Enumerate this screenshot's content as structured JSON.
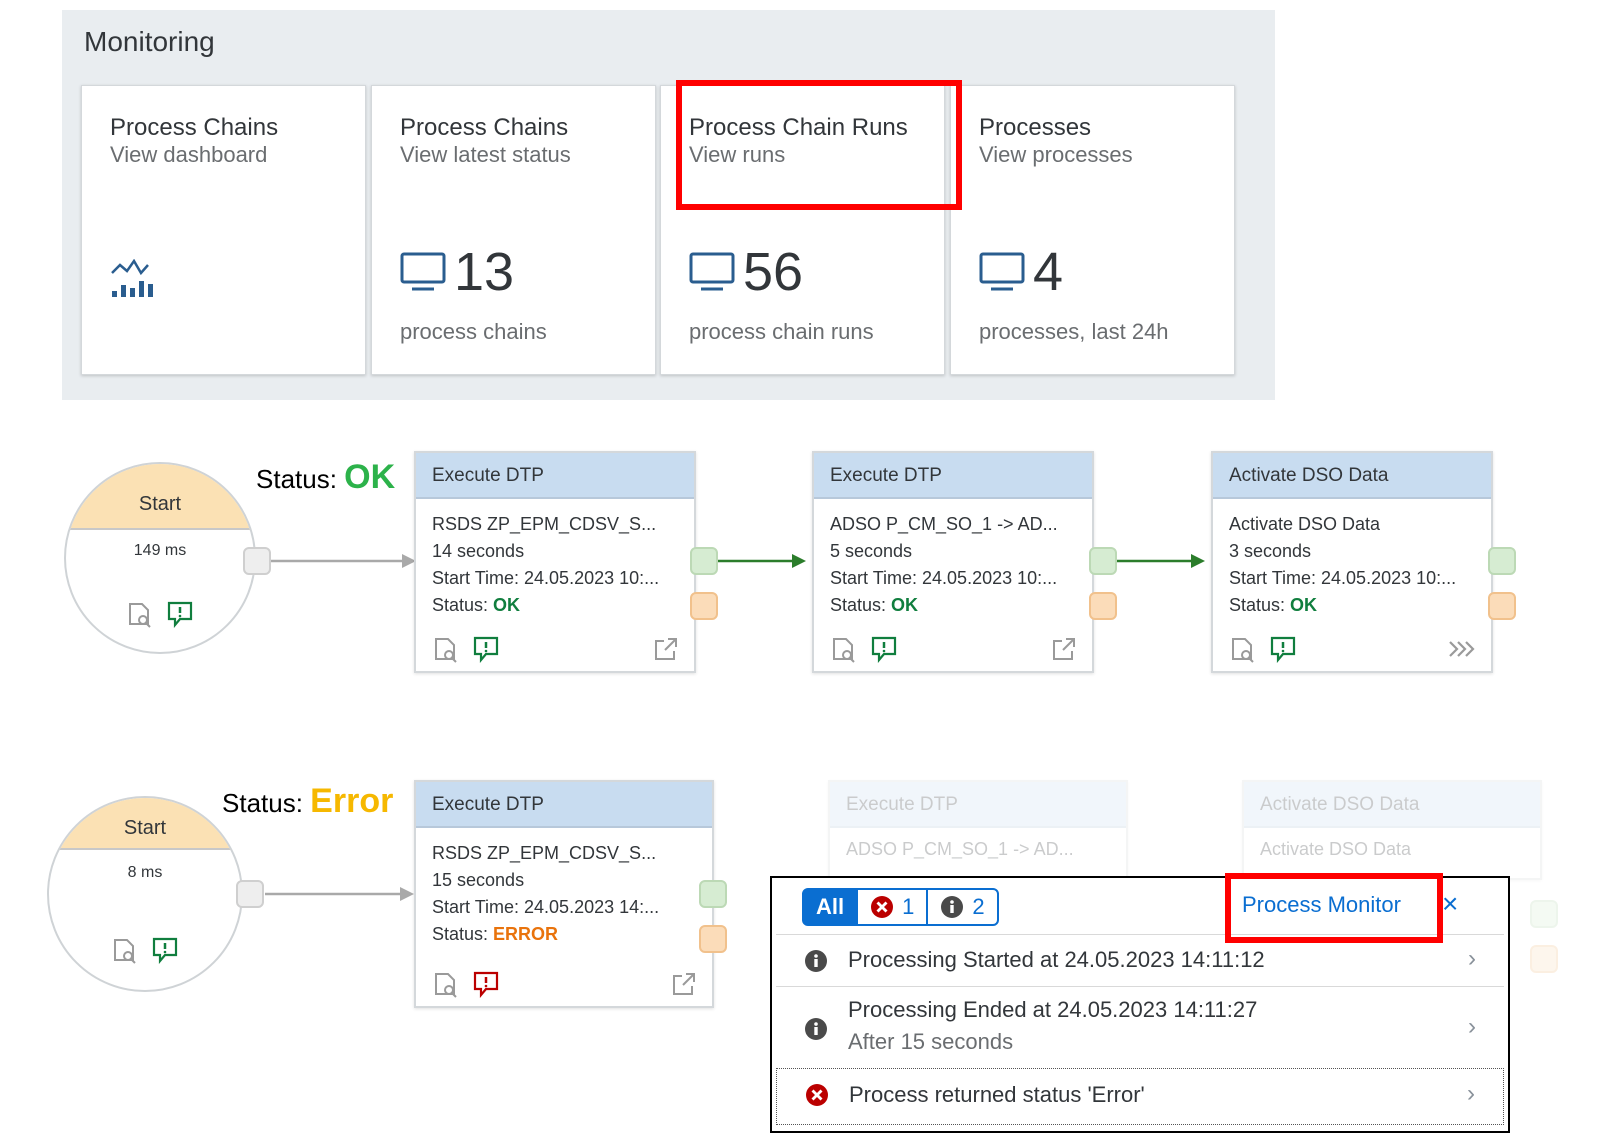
{
  "monitoring": {
    "title": "Monitoring",
    "tiles": [
      {
        "title": "Process Chains",
        "subtitle": "View dashboard",
        "icon": "chart-dashboard-icon",
        "value": "",
        "footer": ""
      },
      {
        "title": "Process Chains",
        "subtitle": "View latest status",
        "icon": "monitor-icon",
        "value": "13",
        "footer": "process chains"
      },
      {
        "title": "Process Chain Runs",
        "subtitle": "View runs",
        "icon": "monitor-icon",
        "value": "56",
        "footer": "process chain runs"
      },
      {
        "title": "Processes",
        "subtitle": "View processes",
        "icon": "monitor-icon",
        "value": "4",
        "footer": "processes, last 24h"
      }
    ]
  },
  "flow_ok": {
    "status_prefix": "Status:",
    "status_value": "OK",
    "start": {
      "label": "Start",
      "duration": "149 ms"
    },
    "nodes": [
      {
        "title": "Execute DTP",
        "line1": "RSDS ZP_EPM_CDSV_S...",
        "line2": "14 seconds",
        "line3": "Start Time: 24.05.2023 10:...",
        "status_label": "Status:",
        "status": "OK"
      },
      {
        "title": "Execute DTP",
        "line1": "ADSO P_CM_SO_1 -> AD...",
        "line2": "5 seconds",
        "line3": "Start Time: 24.05.2023 10:...",
        "status_label": "Status:",
        "status": "OK"
      },
      {
        "title": "Activate DSO Data",
        "line1": "Activate DSO Data",
        "line2": "3 seconds",
        "line3": "Start Time: 24.05.2023 10:...",
        "status_label": "Status:",
        "status": "OK"
      }
    ]
  },
  "flow_error": {
    "status_prefix": "Status:",
    "status_value": "Error",
    "start": {
      "label": "Start",
      "duration": "8 ms"
    },
    "node": {
      "title": "Execute DTP",
      "line1": "RSDS ZP_EPM_CDSV_S...",
      "line2": "15 seconds",
      "line3": "Start Time: 24.05.2023 14:...",
      "status_label": "Status:",
      "status": "ERROR"
    },
    "faded_nodes": [
      {
        "title": "Execute DTP",
        "line1": "ADSO P_CM_SO_1 -> AD..."
      },
      {
        "title": "Activate DSO Data",
        "line1": "Activate DSO Data"
      }
    ]
  },
  "popover": {
    "filters": {
      "all": "All",
      "errors": "1",
      "infos": "2"
    },
    "process_monitor": "Process Monitor",
    "close": "×",
    "messages": [
      {
        "icon": "info-icon",
        "text": "Processing Started at 24.05.2023 14:11:12",
        "sub": ""
      },
      {
        "icon": "info-icon",
        "text": "Processing Ended at 24.05.2023 14:11:27",
        "sub": "After 15 seconds"
      },
      {
        "icon": "error-icon",
        "text": "Process returned status 'Error'",
        "sub": ""
      }
    ]
  },
  "colors": {
    "accent": "#0a6ed1",
    "ok": "#107e3e",
    "error": "#e9730c",
    "highlight": "#ff0000",
    "node_header": "#c8dcf0"
  }
}
